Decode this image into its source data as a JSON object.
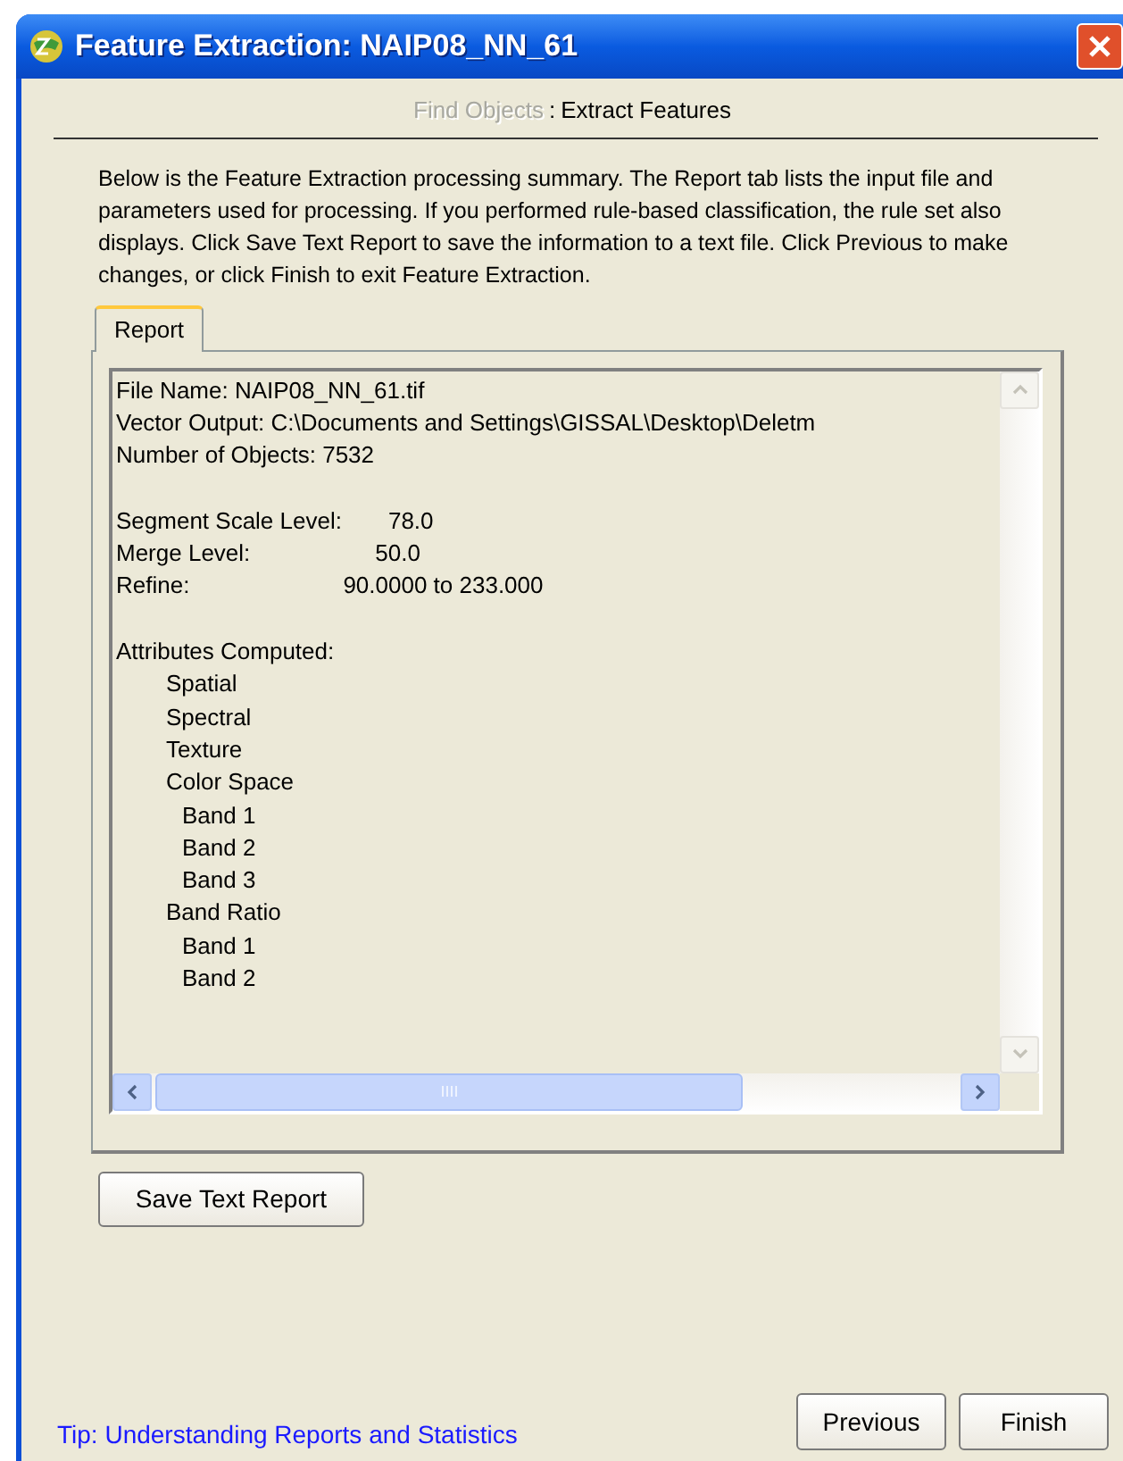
{
  "window": {
    "title": "Feature Extraction: NAIP08_NN_61"
  },
  "steps": [
    {
      "label": "Find Objects",
      "selected": false
    },
    {
      "label": "Extract Features",
      "selected": true
    }
  ],
  "step_separator": ":",
  "description": "Below is the Feature Extraction processing summary. The Report tab lists the input file and parameters used for processing. If you performed rule-based classification, the rule set also displays. Click Save Text Report to save the information to a text file. Click Previous to make changes, or click Finish to exit Feature Extraction.",
  "tabs": [
    {
      "label": "Report",
      "selected": true
    }
  ],
  "report": {
    "info_lines": [
      "File Name: NAIP08_NN_61.tif",
      "Vector Output: C:\\Documents and Settings\\GISSAL\\Desktop\\Deletm",
      "Number of Objects: 7532"
    ],
    "parameters": [
      {
        "label": "Segment Scale Level:",
        "value": "78.0"
      },
      {
        "label": "Merge Level:",
        "value": "50.0"
      },
      {
        "label": "Refine:",
        "value": "90.0000 to 233.000"
      }
    ],
    "attributes": {
      "heading": "Attributes Computed:",
      "children": [
        {
          "label": "Spatial"
        },
        {
          "label": "Spectral"
        },
        {
          "label": "Texture"
        },
        {
          "label": "Color Space",
          "children": [
            {
              "label": "Band 1"
            },
            {
              "label": "Band 2"
            },
            {
              "label": "Band 3"
            }
          ]
        },
        {
          "label": "Band Ratio",
          "children": [
            {
              "label": "Band 1"
            },
            {
              "label": "Band 2"
            }
          ]
        }
      ]
    }
  },
  "save_button": "Save Text Report",
  "tip_link": "Tip: Understanding Reports and Statistics",
  "buttons": [
    "Previous",
    "Finish"
  ]
}
